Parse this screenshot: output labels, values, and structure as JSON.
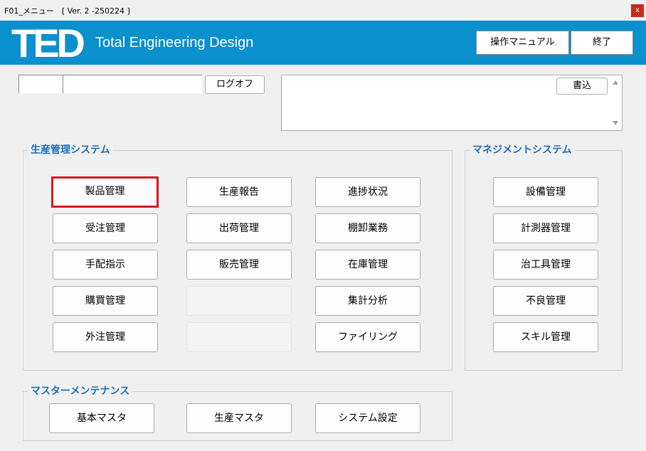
{
  "window": {
    "title": "F01_メニュー　[ Ver. 2 -250224 ]",
    "close_label": "x"
  },
  "header": {
    "logo": "TED",
    "tagline": "Total Engineering Design",
    "manual_label": "操作マニュアル",
    "exit_label": "終了"
  },
  "login": {
    "user_id": "",
    "user_name": "",
    "logoff_label": "ログオフ"
  },
  "memo": {
    "text": "",
    "write_label": "書込"
  },
  "production": {
    "title": "生産管理システム",
    "col1": [
      "製品管理",
      "受注管理",
      "手配指示",
      "購買管理",
      "外注管理"
    ],
    "col2": [
      "生産報告",
      "出荷管理",
      "販売管理",
      "",
      ""
    ],
    "col3": [
      "進捗状況",
      "棚卸業務",
      "在庫管理",
      "集計分析",
      "ファイリング"
    ],
    "selected": "製品管理"
  },
  "management": {
    "title": "マネジメントシステム",
    "items": [
      "設備管理",
      "計測器管理",
      "治工具管理",
      "不良管理",
      "スキル管理"
    ]
  },
  "master": {
    "title": "マスターメンテナンス",
    "items": [
      "基本マスタ",
      "生産マスタ",
      "システム設定"
    ]
  },
  "colors": {
    "header_blue": "#0a90cd",
    "section_title": "#1c6fb7",
    "selected_border": "#d71920"
  }
}
